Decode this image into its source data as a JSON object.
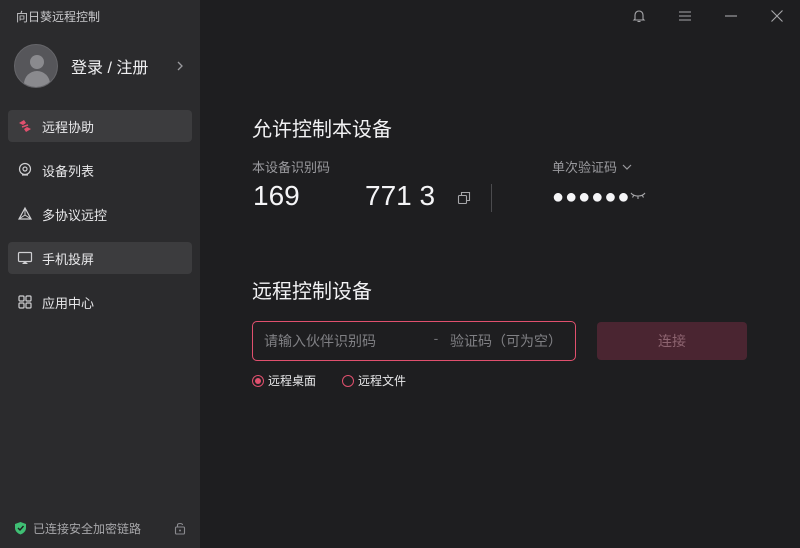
{
  "app": {
    "title": "向日葵远程控制"
  },
  "user": {
    "login_label": "登录 / 注册"
  },
  "nav": {
    "items": [
      {
        "label": "远程协助",
        "icon": "remote-assist-icon",
        "active": true
      },
      {
        "label": "设备列表",
        "icon": "device-list-icon",
        "active": false
      },
      {
        "label": "多协议远控",
        "icon": "multi-protocol-icon",
        "active": false
      },
      {
        "label": "手机投屏",
        "icon": "screen-mirror-icon",
        "active": false
      },
      {
        "label": "应用中心",
        "icon": "app-center-icon",
        "active": false
      }
    ]
  },
  "footer": {
    "status_text": "已连接安全加密链路"
  },
  "allow_control": {
    "title": "允许控制本设备",
    "device_code_label": "本设备识别码",
    "device_code_part1": "169",
    "device_code_part2": "771 3",
    "verification_label": "单次验证码",
    "verification_masked": "●●●●●●"
  },
  "remote_control": {
    "title": "远程控制设备",
    "partner_placeholder": "请输入伙伴识别码",
    "separator": "-",
    "code_placeholder": "验证码（可为空）",
    "connect_label": "连接",
    "options": [
      {
        "label": "远程桌面",
        "checked": true
      },
      {
        "label": "远程文件",
        "checked": false
      }
    ]
  },
  "colors": {
    "accent": "#e0506e",
    "sidebar_bg": "#2b2b2d",
    "main_bg": "#1e1e20",
    "connect_disabled_bg": "#4a2531",
    "secure_green": "#3fbf74"
  }
}
